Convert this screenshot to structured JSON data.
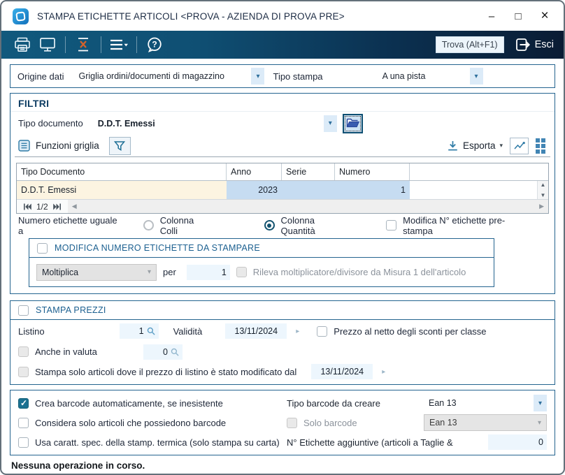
{
  "window": {
    "title": "STAMPA ETICHETTE ARTICOLI <PROVA - AZIENDA DI PROVA PRE>",
    "controls": {
      "minimize": "–",
      "maximize": "□",
      "close": "×"
    }
  },
  "toolbar": {
    "trova": "Trova (Alt+F1)",
    "esci": "Esci"
  },
  "origine": {
    "label": "Origine dati",
    "value": "Griglia ordini/documenti di magazzino",
    "tipo_stampa_label": "Tipo stampa",
    "tipo_stampa_value": "A una pista"
  },
  "filtri": {
    "title": "FILTRI",
    "tipo_documento": {
      "label": "Tipo documento",
      "value": "D.D.T. Emessi"
    },
    "grid_toolbar": {
      "funzioni_label": "Funzioni griglia",
      "esporta_label": "Esporta"
    },
    "table": {
      "columns": [
        "Tipo Documento",
        "Anno",
        "Serie",
        "Numero"
      ],
      "row": {
        "tipo": "D.D.T. Emessi",
        "anno": "2023",
        "serie": "",
        "numero": "1"
      },
      "pagination": "1/2"
    },
    "numero_etichette": {
      "label": "Numero etichette uguale a",
      "colli": "Colonna Colli",
      "quantita": "Colonna Quantità",
      "modifica": "Modifica N° etichette pre-stampa"
    },
    "modifica_gruppo": {
      "title": "MODIFICA NUMERO ETICHETTE DA STAMPARE",
      "operazione": "Moltiplica",
      "per_label": "per",
      "per_value": "1",
      "rileva": "Rileva moltiplicatore/divisore da Misura 1 dell'articolo"
    }
  },
  "stampa_prezzi": {
    "title": "STAMPA PREZZI",
    "listino_label": "Listino",
    "listino_value": "1",
    "validita_label": "Validità",
    "validita_value": "13/11/2024",
    "prezzo_netto": "Prezzo al netto degli sconti per classe",
    "anche_valuta_label": "Anche in valuta",
    "anche_valuta_value": "0",
    "modificato_label": "Stampa solo articoli dove il prezzo di listino è stato modificato dal",
    "modificato_value": "13/11/2024"
  },
  "barcode": {
    "crea": "Crea barcode automaticamente, se inesistente",
    "considera": "Considera solo articoli che possiedono barcode",
    "usa_caratteri": "Usa caratt. spec. della stamp. termica (solo stampa su carta)",
    "tipo_label": "Tipo barcode da creare",
    "tipo_value": "Ean 13",
    "solo_label": "Solo barcode",
    "solo_value": "Ean 13",
    "aggiuntive_label": "N° Etichette aggiuntive (articoli a Taglie &",
    "aggiuntive_value": "0"
  },
  "status": "Nessuna operazione in corso.",
  "colors": {
    "toolbar_left": "#11597d",
    "toolbar_right": "#0a1c34",
    "section_border": "#24648f",
    "accent_teal": "#1b7191",
    "row_cream": "#fcf4e1",
    "row_selected": "#c6dcf1",
    "input_bg": "#edf6fd"
  }
}
